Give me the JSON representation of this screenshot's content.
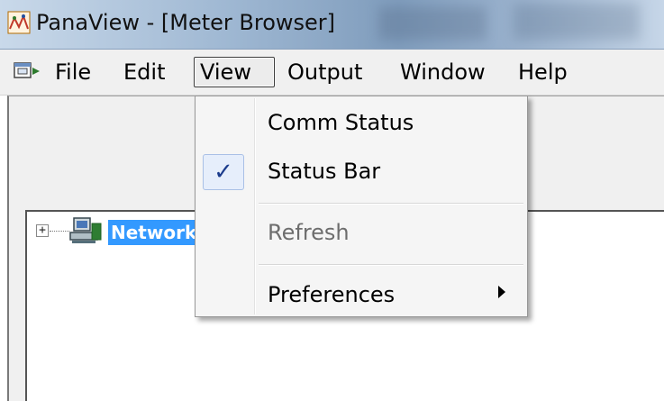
{
  "window": {
    "title": "PanaView - [Meter Browser]"
  },
  "menubar": {
    "items": [
      {
        "label": "File"
      },
      {
        "label": "Edit"
      },
      {
        "label": "View"
      },
      {
        "label": "Output"
      },
      {
        "label": "Window"
      },
      {
        "label": "Help"
      }
    ],
    "open_menu": "View"
  },
  "view_menu": {
    "items": [
      {
        "label": "Comm Status",
        "checked": false,
        "enabled": true
      },
      {
        "label": "Status Bar",
        "checked": true,
        "enabled": true
      },
      {
        "label": "Refresh",
        "checked": false,
        "enabled": false
      },
      {
        "label": "Preferences",
        "checked": false,
        "enabled": true,
        "has_submenu": true
      }
    ],
    "check_glyph": "✓"
  },
  "tree": {
    "root": {
      "label": "Network",
      "expander": "+",
      "selected": true
    }
  },
  "icons": {
    "app": "panaview-app-icon",
    "mdi": "mdi-child-icon",
    "tree_node": "network-computer-icon",
    "submenu": "submenu-arrow-icon"
  },
  "colors": {
    "selection": "#3399ff",
    "check": "#1c3c8c"
  }
}
